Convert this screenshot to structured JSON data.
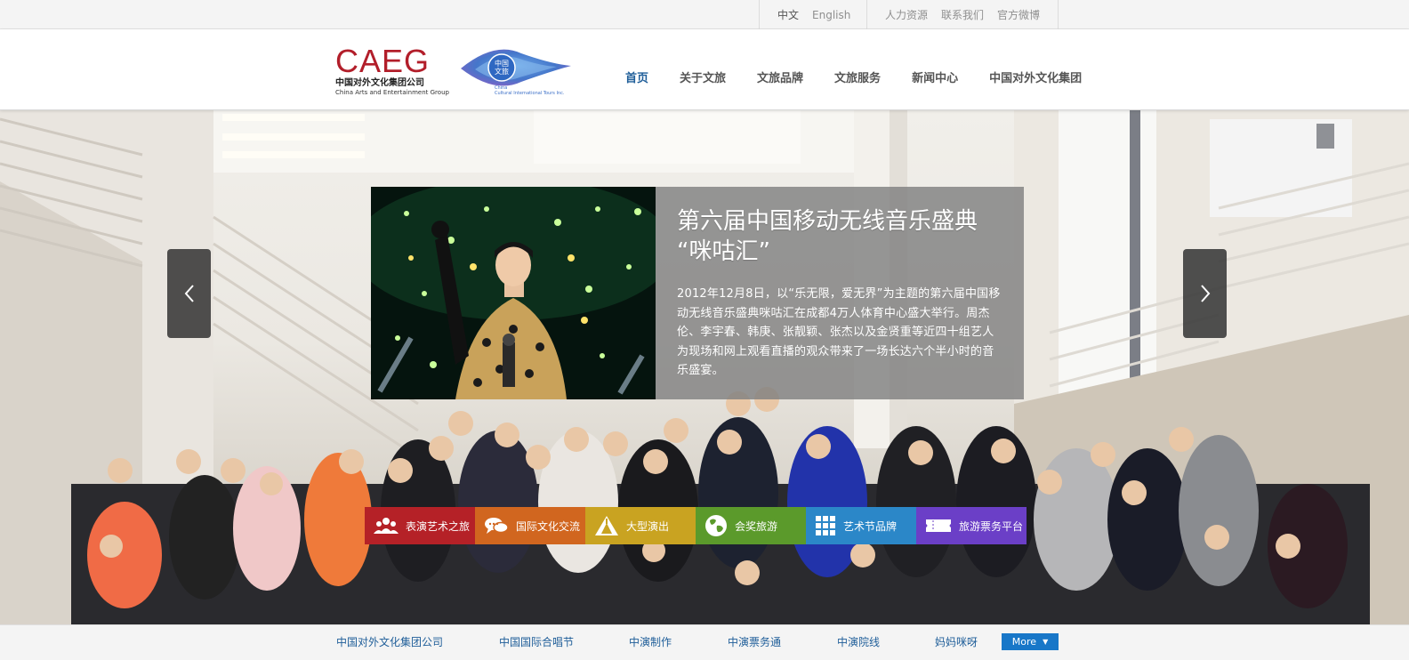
{
  "topbar": {
    "lang_cn": "中文",
    "lang_en": "English",
    "links": [
      "人力资源",
      "联系我们",
      "官方微博"
    ]
  },
  "brand": {
    "caeg": "CAEG",
    "caeg_cn": "中国对外文化集团公司",
    "caeg_en": "China Arts and Entertainment Group",
    "cit_mark_line1": "中国",
    "cit_mark_line2": "文旅",
    "cit_en_line1": "China",
    "cit_en_line2": "Cultural International Tours Inc.",
    "caeg_color": "#b21e2a",
    "cit_color": "#3b6fc7"
  },
  "nav": {
    "items": [
      "首页",
      "关于文旅",
      "文旅品牌",
      "文旅服务",
      "新闻中心",
      "中国对外文化集团"
    ],
    "active_index": 0,
    "active_color": "#1f5e99"
  },
  "slide": {
    "title": "第六届中国移动无线音乐盛典\n“咪咕汇”",
    "body": "2012年12月8日，以“乐无限，爱无界”为主题的第六届中国移动无线音乐盛典咪咕汇在成都4万人体育中心盛大举行。周杰伦、李宇春、韩庚、张靓颖、张杰以及金贤重等近四十组艺人为现场和网上观看直播的观众带来了一场长达六个半小时的音乐盛宴。"
  },
  "carousel": {
    "prev_icon": "chevron-left-icon",
    "next_icon": "chevron-right-icon"
  },
  "categories": [
    {
      "label": "表演艺术之旅",
      "color": "#b52127",
      "icon": "group-icon"
    },
    {
      "label": "国际文化交流",
      "color": "#d1661f",
      "icon": "chat-icon"
    },
    {
      "label": "大型演出",
      "color": "#c9a321",
      "icon": "stage-icon"
    },
    {
      "label": "会奖旅游",
      "color": "#5b9a2b",
      "icon": "globe-icon"
    },
    {
      "label": "艺术节品牌",
      "color": "#2b87c8",
      "icon": "grid-icon"
    },
    {
      "label": "旅游票务平台",
      "color": "#6b3fc7",
      "icon": "ticket-icon"
    }
  ],
  "footer": {
    "links": [
      "中国对外文化集团公司",
      "中国国际合唱节",
      "中演制作",
      "中演票务通",
      "中演院线",
      "妈妈咪呀"
    ],
    "more_label": "More"
  }
}
